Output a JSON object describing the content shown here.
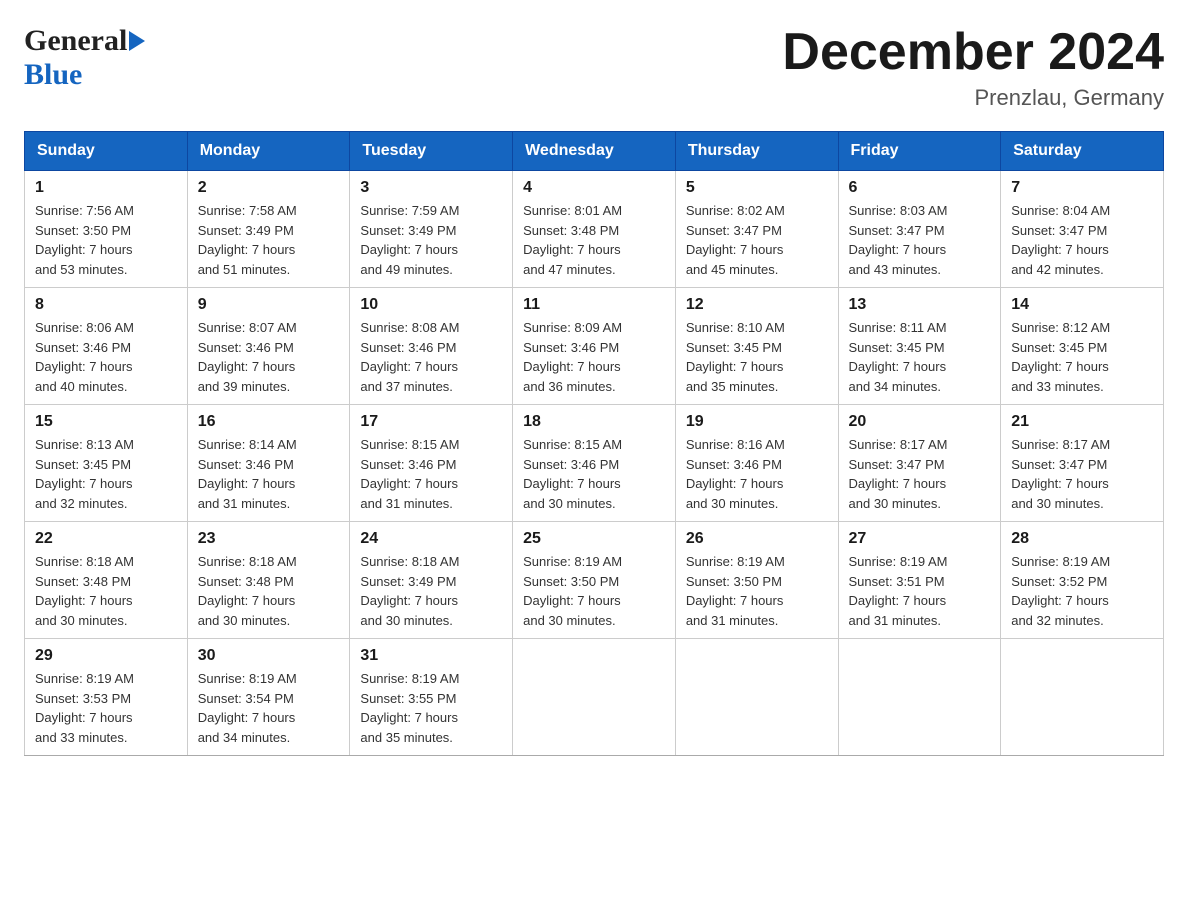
{
  "header": {
    "logo_general": "General",
    "logo_blue": "Blue",
    "month_title": "December 2024",
    "location": "Prenzlau, Germany"
  },
  "days_of_week": [
    "Sunday",
    "Monday",
    "Tuesday",
    "Wednesday",
    "Thursday",
    "Friday",
    "Saturday"
  ],
  "weeks": [
    [
      {
        "day": "1",
        "sunrise": "7:56 AM",
        "sunset": "3:50 PM",
        "daylight": "7 hours and 53 minutes."
      },
      {
        "day": "2",
        "sunrise": "7:58 AM",
        "sunset": "3:49 PM",
        "daylight": "7 hours and 51 minutes."
      },
      {
        "day": "3",
        "sunrise": "7:59 AM",
        "sunset": "3:49 PM",
        "daylight": "7 hours and 49 minutes."
      },
      {
        "day": "4",
        "sunrise": "8:01 AM",
        "sunset": "3:48 PM",
        "daylight": "7 hours and 47 minutes."
      },
      {
        "day": "5",
        "sunrise": "8:02 AM",
        "sunset": "3:47 PM",
        "daylight": "7 hours and 45 minutes."
      },
      {
        "day": "6",
        "sunrise": "8:03 AM",
        "sunset": "3:47 PM",
        "daylight": "7 hours and 43 minutes."
      },
      {
        "day": "7",
        "sunrise": "8:04 AM",
        "sunset": "3:47 PM",
        "daylight": "7 hours and 42 minutes."
      }
    ],
    [
      {
        "day": "8",
        "sunrise": "8:06 AM",
        "sunset": "3:46 PM",
        "daylight": "7 hours and 40 minutes."
      },
      {
        "day": "9",
        "sunrise": "8:07 AM",
        "sunset": "3:46 PM",
        "daylight": "7 hours and 39 minutes."
      },
      {
        "day": "10",
        "sunrise": "8:08 AM",
        "sunset": "3:46 PM",
        "daylight": "7 hours and 37 minutes."
      },
      {
        "day": "11",
        "sunrise": "8:09 AM",
        "sunset": "3:46 PM",
        "daylight": "7 hours and 36 minutes."
      },
      {
        "day": "12",
        "sunrise": "8:10 AM",
        "sunset": "3:45 PM",
        "daylight": "7 hours and 35 minutes."
      },
      {
        "day": "13",
        "sunrise": "8:11 AM",
        "sunset": "3:45 PM",
        "daylight": "7 hours and 34 minutes."
      },
      {
        "day": "14",
        "sunrise": "8:12 AM",
        "sunset": "3:45 PM",
        "daylight": "7 hours and 33 minutes."
      }
    ],
    [
      {
        "day": "15",
        "sunrise": "8:13 AM",
        "sunset": "3:45 PM",
        "daylight": "7 hours and 32 minutes."
      },
      {
        "day": "16",
        "sunrise": "8:14 AM",
        "sunset": "3:46 PM",
        "daylight": "7 hours and 31 minutes."
      },
      {
        "day": "17",
        "sunrise": "8:15 AM",
        "sunset": "3:46 PM",
        "daylight": "7 hours and 31 minutes."
      },
      {
        "day": "18",
        "sunrise": "8:15 AM",
        "sunset": "3:46 PM",
        "daylight": "7 hours and 30 minutes."
      },
      {
        "day": "19",
        "sunrise": "8:16 AM",
        "sunset": "3:46 PM",
        "daylight": "7 hours and 30 minutes."
      },
      {
        "day": "20",
        "sunrise": "8:17 AM",
        "sunset": "3:47 PM",
        "daylight": "7 hours and 30 minutes."
      },
      {
        "day": "21",
        "sunrise": "8:17 AM",
        "sunset": "3:47 PM",
        "daylight": "7 hours and 30 minutes."
      }
    ],
    [
      {
        "day": "22",
        "sunrise": "8:18 AM",
        "sunset": "3:48 PM",
        "daylight": "7 hours and 30 minutes."
      },
      {
        "day": "23",
        "sunrise": "8:18 AM",
        "sunset": "3:48 PM",
        "daylight": "7 hours and 30 minutes."
      },
      {
        "day": "24",
        "sunrise": "8:18 AM",
        "sunset": "3:49 PM",
        "daylight": "7 hours and 30 minutes."
      },
      {
        "day": "25",
        "sunrise": "8:19 AM",
        "sunset": "3:50 PM",
        "daylight": "7 hours and 30 minutes."
      },
      {
        "day": "26",
        "sunrise": "8:19 AM",
        "sunset": "3:50 PM",
        "daylight": "7 hours and 31 minutes."
      },
      {
        "day": "27",
        "sunrise": "8:19 AM",
        "sunset": "3:51 PM",
        "daylight": "7 hours and 31 minutes."
      },
      {
        "day": "28",
        "sunrise": "8:19 AM",
        "sunset": "3:52 PM",
        "daylight": "7 hours and 32 minutes."
      }
    ],
    [
      {
        "day": "29",
        "sunrise": "8:19 AM",
        "sunset": "3:53 PM",
        "daylight": "7 hours and 33 minutes."
      },
      {
        "day": "30",
        "sunrise": "8:19 AM",
        "sunset": "3:54 PM",
        "daylight": "7 hours and 34 minutes."
      },
      {
        "day": "31",
        "sunrise": "8:19 AM",
        "sunset": "3:55 PM",
        "daylight": "7 hours and 35 minutes."
      },
      null,
      null,
      null,
      null
    ]
  ],
  "labels": {
    "sunrise": "Sunrise:",
    "sunset": "Sunset:",
    "daylight": "Daylight:"
  }
}
